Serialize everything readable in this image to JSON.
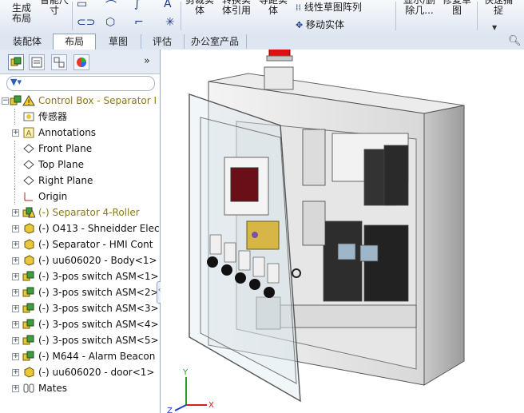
{
  "ribbon": {
    "items": [
      {
        "label": "生成\n布局"
      },
      {
        "label": "智能尺\n寸"
      },
      {
        "label": "剪裁实\n体"
      },
      {
        "label": "转换实\n体引用"
      },
      {
        "label": "等距实\n体"
      },
      {
        "label": "线性草图阵列"
      },
      {
        "label": "移动实体"
      },
      {
        "label": "显示/删\n除几..."
      },
      {
        "label": "修复草\n图"
      },
      {
        "label": "快速捕\n捉"
      }
    ]
  },
  "tabs": [
    {
      "label": "装配体"
    },
    {
      "label": "布局"
    },
    {
      "label": "草图"
    },
    {
      "label": "评估"
    },
    {
      "label": "办公室产品"
    }
  ],
  "tree": {
    "root": "Control Box - Separator I",
    "items": [
      {
        "label": "传感器",
        "icon": "sensor-icon"
      },
      {
        "label": "Annotations",
        "icon": "annotations-icon"
      },
      {
        "label": "Front Plane",
        "icon": "plane-icon"
      },
      {
        "label": "Top Plane",
        "icon": "plane-icon"
      },
      {
        "label": "Right Plane",
        "icon": "plane-icon"
      },
      {
        "label": "Origin",
        "icon": "origin-icon"
      },
      {
        "label": "(-) Separator 4-Roller",
        "icon": "subassembly-warning-icon"
      },
      {
        "label": "(-) O413 - Shneidder Elec",
        "icon": "part-icon"
      },
      {
        "label": "(-) Separator - HMI Cont",
        "icon": "part-icon"
      },
      {
        "label": "(-) uu606020 - Body<1>",
        "icon": "part-icon"
      },
      {
        "label": "(-) 3-pos switch ASM<1>",
        "icon": "subassembly-icon"
      },
      {
        "label": "(-) 3-pos switch ASM<2>",
        "icon": "subassembly-icon"
      },
      {
        "label": "(-) 3-pos switch ASM<3>",
        "icon": "subassembly-icon"
      },
      {
        "label": "(-) 3-pos switch ASM<4>",
        "icon": "subassembly-icon"
      },
      {
        "label": "(-) 3-pos switch ASM<5>",
        "icon": "subassembly-icon"
      },
      {
        "label": "(-) M644 - Alarm Beacon",
        "icon": "subassembly-icon"
      },
      {
        "label": "(-) uu606020 - door<1>",
        "icon": "part-icon"
      },
      {
        "label": "Mates",
        "icon": "mates-icon"
      }
    ]
  },
  "triad": {
    "x": "X",
    "y": "Y",
    "z": "Z"
  },
  "colors": {
    "accent": "#1c3a8a",
    "beacon": "#e01010",
    "panel_bg": "#ffffff"
  }
}
